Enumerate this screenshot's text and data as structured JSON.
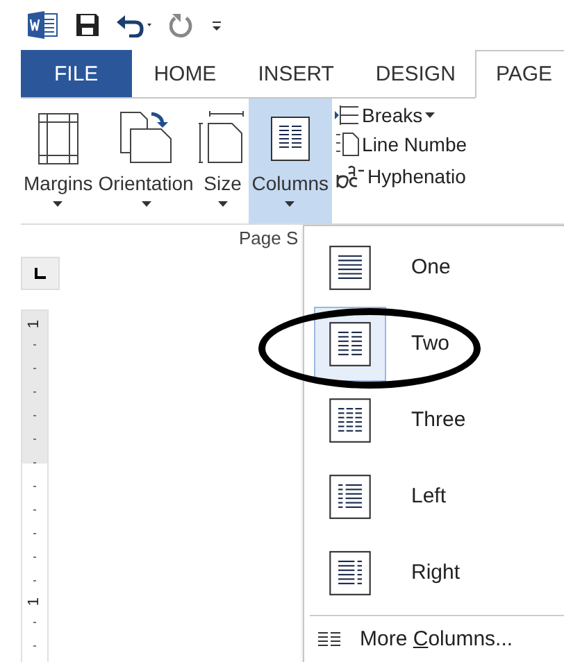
{
  "quick_access": {
    "items": [
      {
        "kind": "word-logo"
      },
      {
        "kind": "save"
      },
      {
        "kind": "undo"
      },
      {
        "kind": "redo"
      },
      {
        "kind": "customize"
      }
    ]
  },
  "tabs": [
    {
      "label": "FILE",
      "kind": "file",
      "selected": false
    },
    {
      "label": "HOME",
      "kind": "tab",
      "selected": false
    },
    {
      "label": "INSERT",
      "kind": "tab",
      "selected": false
    },
    {
      "label": "DESIGN",
      "kind": "tab",
      "selected": false
    },
    {
      "label": "PAGE",
      "kind": "tab",
      "selected": true
    }
  ],
  "ribbon": {
    "large_buttons": [
      {
        "label": "Margins",
        "kind": "margins",
        "selected": false
      },
      {
        "label": "Orientation",
        "kind": "orientation",
        "selected": false
      },
      {
        "label": "Size",
        "kind": "size",
        "selected": false
      },
      {
        "label": "Columns",
        "kind": "columns",
        "selected": true
      }
    ],
    "small_buttons": [
      {
        "label": "Breaks",
        "kind": "breaks",
        "dropdown": true
      },
      {
        "label": "Line Numbe",
        "kind": "line-numbers",
        "dropdown": false
      },
      {
        "label": "Hyphenatio",
        "kind": "hyphenation",
        "dropdown": false
      }
    ],
    "group_label": "Page S"
  },
  "ruler": {
    "labels": [
      "1",
      "1"
    ]
  },
  "columns_menu": {
    "items": [
      {
        "label": "One",
        "kind": "one",
        "selected": false
      },
      {
        "label": "Two",
        "kind": "two",
        "selected": true
      },
      {
        "label": "Three",
        "kind": "three",
        "selected": false
      },
      {
        "label": "Left",
        "kind": "left",
        "selected": false
      },
      {
        "label": "Right",
        "kind": "right",
        "selected": false
      }
    ],
    "more": {
      "before": "More ",
      "mnemonic": "C",
      "after": "olumns..."
    }
  },
  "annotation": {
    "kind": "ellipse"
  }
}
